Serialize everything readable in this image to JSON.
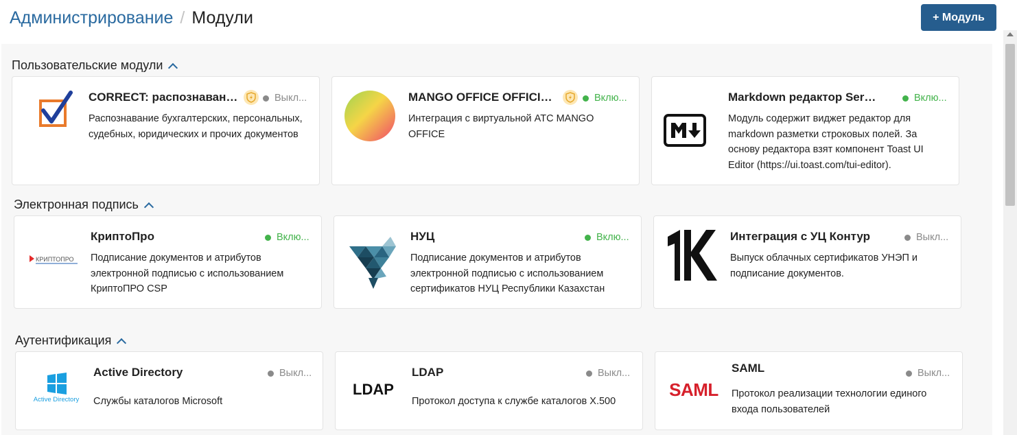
{
  "header": {
    "breadcrumb_root": "Администрирование",
    "breadcrumb_separator": "/",
    "breadcrumb_current": "Модули",
    "add_button_label": "+ Модуль"
  },
  "colors": {
    "primary": "#265d8e",
    "link": "#2a6aa0",
    "status_on": "#43b34b",
    "status_off": "#8a8a8a",
    "badge_bg": "#fde7b4"
  },
  "sections": [
    {
      "title": "Пользовательские модули",
      "cards": [
        {
          "title": "CORRECT: распознавание...",
          "status": "Выкл...",
          "status_state": "off",
          "badge": "shield-bolt-icon",
          "logo": "correct-checkbox-logo",
          "desc": "Распознавание бухгалтерских, персональных, судебных, юридических и прочих документов"
        },
        {
          "title": "MANGO OFFICE OFFICIAL",
          "status": "Вклю...",
          "status_state": "on",
          "badge": "shield-bolt-icon",
          "logo": "mango-gradient-logo",
          "desc": "Интеграция с виртуальной АТС MANGO OFFICE"
        },
        {
          "title": "Markdown редактор Servi...",
          "status": "Вклю...",
          "status_state": "on",
          "logo": "markdown-logo",
          "desc": "Модуль содержит виджет редактор для markdown разметки строковых полей. За основу редактора взят компонент Toast UI Editor (https://ui.toast.com/tui-editor)."
        }
      ]
    },
    {
      "title": "Электронная подпись",
      "cards": [
        {
          "title": "КриптоПро",
          "status": "Вклю...",
          "status_state": "on",
          "logo": "cryptopro-logo",
          "logo_text": "КРИПТОПРО",
          "desc": "Подписание документов и атрибутов электронной подписью с использованием КриптоПРО CSP"
        },
        {
          "title": "НУЦ",
          "status": "Вклю...",
          "status_state": "on",
          "logo": "nuc-triangles-logo",
          "desc": "Подписание документов и атрибутов электронной подписью с использованием сертификатов НУЦ Республики Казахстан"
        },
        {
          "title": "Интеграция с УЦ Контур",
          "status": "Выкл...",
          "status_state": "off",
          "logo": "kontur-k-logo",
          "desc": "Выпуск облачных сертификатов УНЭП и подписание документов."
        }
      ]
    },
    {
      "title": "Аутентификация",
      "cards": [
        {
          "title": "Active Directory",
          "status": "Выкл...",
          "status_state": "off",
          "logo": "active-directory-logo",
          "logo_text": "Active Directory",
          "desc": "Службы каталогов Microsoft"
        },
        {
          "title": "LDAP",
          "status": "Выкл...",
          "status_state": "off",
          "logo": "ldap-logo",
          "logo_text": "LDAP",
          "desc": "Протокол доступа к службе каталогов X.500"
        },
        {
          "title": "SAML",
          "status": "Выкл...",
          "status_state": "off",
          "logo": "saml-logo",
          "logo_text": "SAML",
          "desc": "Протокол реализации технологии единого входа пользователей"
        }
      ]
    }
  ]
}
